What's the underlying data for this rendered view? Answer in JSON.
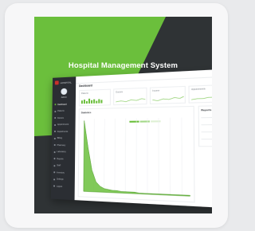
{
  "title": "Hospital Management System",
  "colors": {
    "brand_green": "#6bbf3c",
    "dark": "#2f3335",
    "brand_red": "#c8322b"
  },
  "screenshot": {
    "brand": "HOSPITAL",
    "user_name": "Admin",
    "nav_items": [
      {
        "label": "Dashboard",
        "active": true
      },
      {
        "label": "Patients",
        "active": false
      },
      {
        "label": "Doctors",
        "active": false
      },
      {
        "label": "Appointments",
        "active": false
      },
      {
        "label": "Departments",
        "active": false
      },
      {
        "label": "Billing",
        "active": false
      },
      {
        "label": "Pharmacy",
        "active": false
      },
      {
        "label": "Laboratory",
        "active": false
      },
      {
        "label": "Reports",
        "active": false
      },
      {
        "label": "Staff",
        "active": false
      },
      {
        "label": "Inventory",
        "active": false
      },
      {
        "label": "Settings",
        "active": false
      },
      {
        "label": "Logout",
        "active": false
      }
    ],
    "page_title": "Dashboard",
    "stats": [
      {
        "label": "Patients",
        "value": "",
        "spark": "bars"
      },
      {
        "label": "Doctors",
        "value": "",
        "spark": "line"
      },
      {
        "label": "Income",
        "value": "",
        "spark": "line"
      },
      {
        "label": "Appointments",
        "value": "",
        "spark": "line"
      }
    ],
    "main_panel": {
      "title": "Statistics",
      "subtitle": ""
    },
    "right_panel": {
      "title": "Reports",
      "items": [
        "",
        "",
        ""
      ]
    }
  },
  "chart_data": {
    "type": "area",
    "title": "",
    "series": [
      {
        "values": [
          100,
          62,
          30,
          14,
          8,
          5,
          4,
          3,
          3,
          2,
          2,
          2,
          2,
          1,
          1,
          1,
          1,
          1,
          1,
          1,
          1,
          1,
          1,
          1,
          1
        ]
      }
    ],
    "color": "#6bbf3c"
  }
}
